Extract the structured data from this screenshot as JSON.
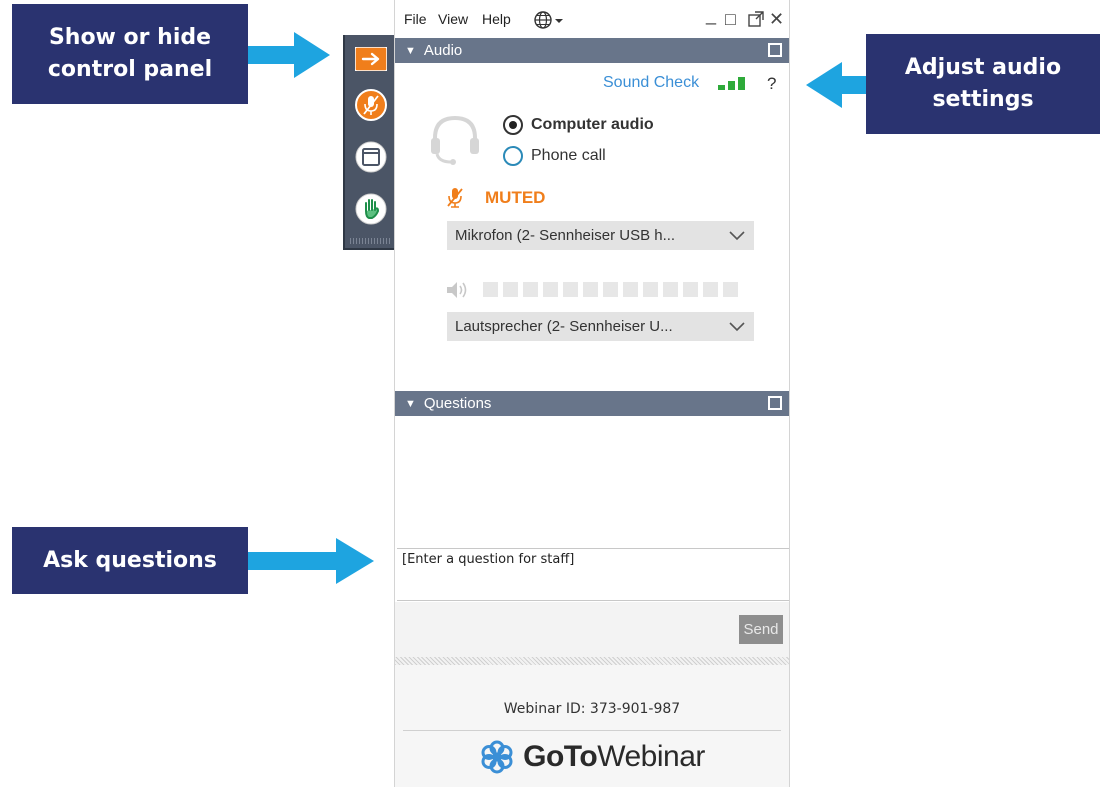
{
  "callouts": {
    "show_hide": "Show or hide control panel",
    "adjust_audio": "Adjust audio settings",
    "ask_questions": "Ask questions"
  },
  "colors": {
    "callout_bg": "#2a3370",
    "arrow": "#1ea4e0",
    "section_header": "#68758a",
    "rail_bg": "#4b5566",
    "muted_orange": "#f07e1b",
    "link_blue": "#3b8fd6",
    "meter_green": "#2eaa3a"
  },
  "menu": {
    "file": "File",
    "view": "View",
    "help": "Help",
    "language_icon": "globe-icon"
  },
  "window_controls": {
    "minimize": "_",
    "maximize": "□",
    "popout_icon": "popout-icon",
    "close": "✕"
  },
  "rail": {
    "items": [
      {
        "icon": "arrow-right-icon",
        "state": "active"
      },
      {
        "icon": "mic-muted-icon"
      },
      {
        "icon": "screen-icon"
      },
      {
        "icon": "raise-hand-icon"
      }
    ]
  },
  "audio": {
    "header": "Audio",
    "sound_check": "Sound Check",
    "help": "?",
    "options": [
      {
        "label": "Computer audio",
        "selected": true
      },
      {
        "label": "Phone call",
        "selected": false
      }
    ],
    "status": "MUTED",
    "microphone": "Mikrofon (2- Sennheiser USB h...",
    "speaker": "Lautsprecher (2- Sennheiser U..."
  },
  "questions": {
    "header": "Questions",
    "placeholder": "[Enter a question for staff]",
    "send": "Send"
  },
  "footer": {
    "webinar_id": "Webinar ID: 373-901-987",
    "brand_bold": "GoTo",
    "brand_regular": "Webinar"
  }
}
